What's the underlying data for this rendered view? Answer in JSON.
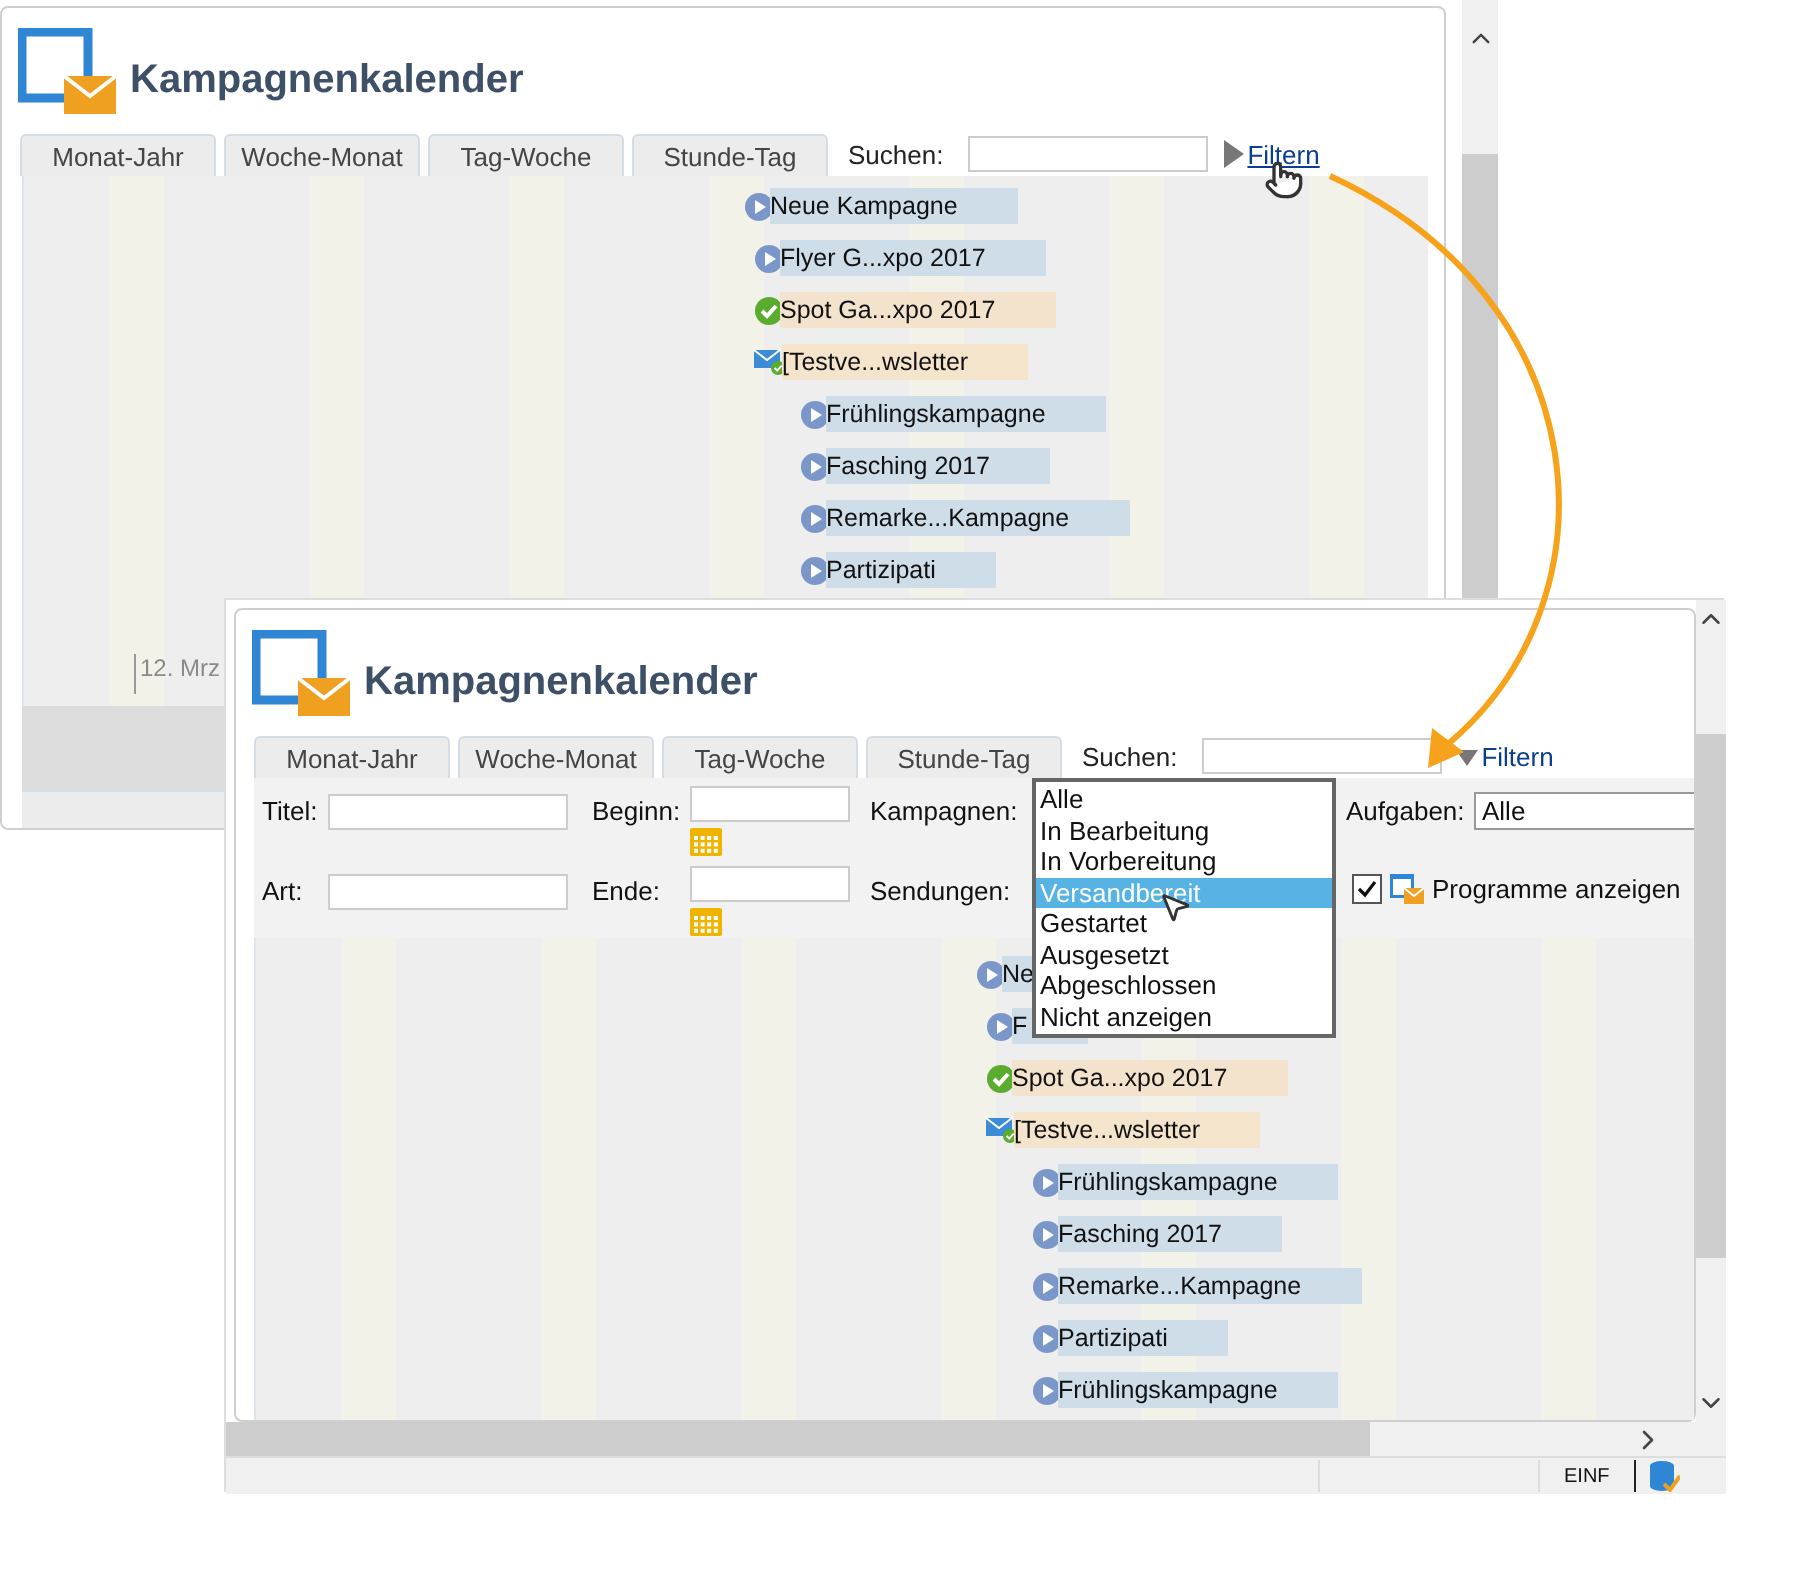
{
  "windows": [
    {
      "kind": "back",
      "title": "Kampagnenkalender",
      "tabs": [
        {
          "label": "Monat-Jahr",
          "selected": false
        },
        {
          "label": "Woche-Monat",
          "selected": false
        },
        {
          "label": "Tag-Woche",
          "selected": false
        },
        {
          "label": "Stunde-Tag",
          "selected": false
        }
      ],
      "search_label": "Suchen:",
      "filter": {
        "label": "Filtern",
        "expanded": false,
        "hovered": true
      },
      "events": [
        {
          "kind": "campaign",
          "label": "Neue Kampagne",
          "children": [
            {
              "kind": "campaign",
              "label": "Flyer G...xpo 2017"
            },
            {
              "kind": "done",
              "label": "Spot Ga...xpo 2017"
            },
            {
              "kind": "delivery",
              "label": "[Testve...wsletter",
              "children": [
                {
                  "kind": "campaign",
                  "label": "Frühlingskampagne"
                },
                {
                  "kind": "campaign",
                  "label": "Fasching 2017"
                },
                {
                  "kind": "campaign",
                  "label": "Remarke...Kampagne"
                },
                {
                  "kind": "campaign",
                  "label": "Partizipati"
                }
              ]
            }
          ]
        }
      ],
      "axis": [
        "12. Mrz"
      ]
    },
    {
      "kind": "front",
      "title": "Kampagnenkalender",
      "tabs": [
        {
          "label": "Monat-Jahr",
          "selected": false
        },
        {
          "label": "Woche-Monat",
          "selected": false
        },
        {
          "label": "Tag-Woche",
          "selected": false
        },
        {
          "label": "Stunde-Tag",
          "selected": false
        }
      ],
      "search_label": "Suchen:",
      "filter": {
        "label": "Filtern",
        "expanded": true,
        "hovered": false
      },
      "filters": {
        "title_label": "Titel:",
        "start_label": "Beginn:",
        "campaigns_label": "Kampagnen:",
        "tasks_label": "Aufgaben:",
        "tasks_value": "Alle",
        "type_label": "Art:",
        "end_label": "Ende:",
        "deliveries_label": "Sendungen:",
        "programs": {
          "label": "Programme anzeigen",
          "checked": true
        }
      },
      "dropdown": [
        {
          "label": "Alle",
          "selected": false
        },
        {
          "label": "In Bearbeitung",
          "selected": false
        },
        {
          "label": "In Vorbereitung",
          "selected": false
        },
        {
          "label": "Versandbereit",
          "selected": true
        },
        {
          "label": "Gestartet",
          "selected": false
        },
        {
          "label": "Ausgesetzt",
          "selected": false
        },
        {
          "label": "Abgeschlossen",
          "selected": false
        },
        {
          "label": "Nicht anzeigen",
          "selected": false
        }
      ],
      "events": [
        {
          "kind": "campaign",
          "label": "Ne",
          "children": [
            {
              "kind": "campaign",
              "label": "F"
            },
            {
              "kind": "done",
              "label": "Spot Ga...xpo 2017"
            },
            {
              "kind": "delivery",
              "label": "[Testve...wsletter",
              "children": [
                {
                  "kind": "campaign",
                  "label": "Frühlingskampagne"
                },
                {
                  "kind": "campaign",
                  "label": "Fasching 2017"
                },
                {
                  "kind": "campaign",
                  "label": "Remarke...Kampagne"
                },
                {
                  "kind": "campaign",
                  "label": "Partizipati"
                },
                {
                  "kind": "campaign",
                  "label": "Frühlingskampagne"
                }
              ]
            }
          ]
        }
      ],
      "status_bar": {
        "mode": "EINF"
      }
    }
  ]
}
